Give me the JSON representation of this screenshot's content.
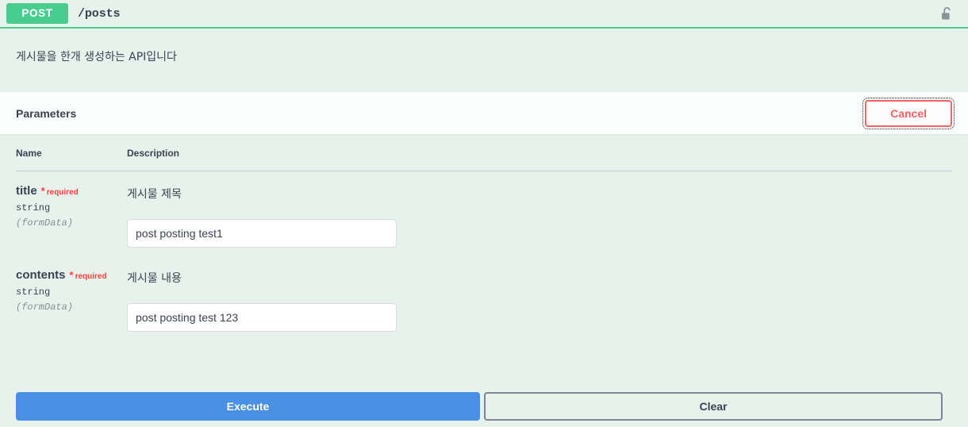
{
  "operation": {
    "method": "POST",
    "path": "/posts",
    "description": "게시물을 한개 생성하는 API입니다",
    "auth_icon": "unlock-icon"
  },
  "parameters_section": {
    "title": "Parameters",
    "cancel_label": "Cancel",
    "columns": {
      "name": "Name",
      "description": "Description"
    },
    "rows": [
      {
        "name": "title",
        "required_star": "*",
        "required_text": "required",
        "type": "string",
        "in": "(formData)",
        "description": "게시물 제목",
        "value": "post posting test1",
        "placeholder": "title"
      },
      {
        "name": "contents",
        "required_star": "*",
        "required_text": "required",
        "type": "string",
        "in": "(formData)",
        "description": "게시물 내용",
        "value": "post posting test 123",
        "placeholder": "contents"
      }
    ]
  },
  "actions": {
    "execute_label": "Execute",
    "clear_label": "Clear"
  },
  "colors": {
    "method_post": "#49cc90",
    "execute_blue": "#4990e2",
    "cancel_red": "#ff6060",
    "required_red": "#f93e3e",
    "band_green": "#e8f2ec",
    "section_white": "#fbfcfc"
  }
}
